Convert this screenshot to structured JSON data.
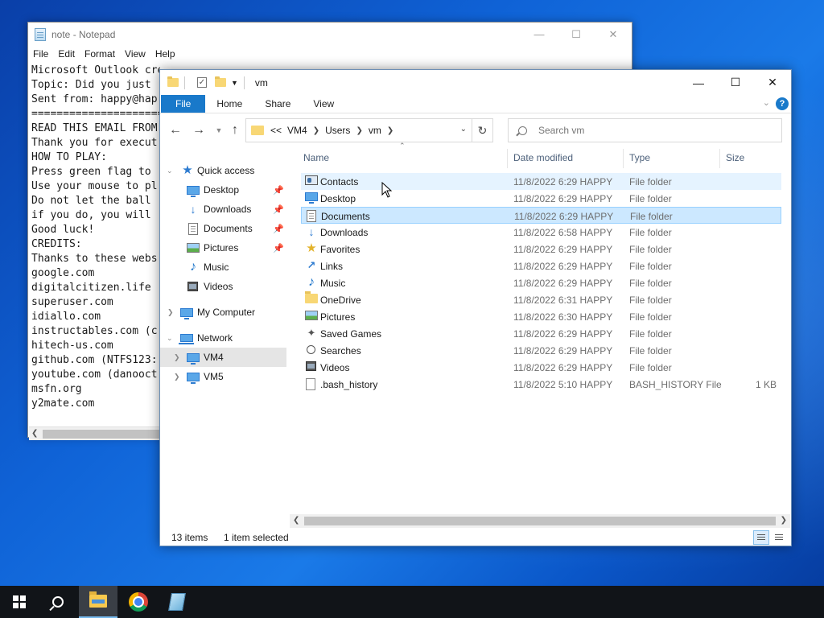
{
  "notepad": {
    "title": "note - Notepad",
    "menu": [
      "File",
      "Edit",
      "Format",
      "View",
      "Help"
    ],
    "lines": [
      "Microsoft Outlook created a .txt document. You have just recieved a new email",
      "Topic: Did you just",
      "Sent from: happy@hap",
      "========================",
      "READ THIS EMAIL FROM",
      "Thank you for execut",
      "HOW TO PLAY:",
      "Press green flag to",
      "Use your mouse to pl",
      "Do not let the ball",
      "if you do, you will",
      "Good luck!",
      "CREDITS:",
      "Thanks to these webs",
      "google.com",
      "digitalcitizen.life",
      "superuser.com",
      "idiallo.com",
      "instructables.com (c",
      "hitech-us.com",
      "github.com (NTFS123:",
      "youtube.com (danooct",
      "msfn.org",
      "y2mate.com"
    ]
  },
  "explorer": {
    "title": "vm",
    "ribbon": {
      "file": "File",
      "home": "Home",
      "share": "Share",
      "view": "View",
      "help": "?"
    },
    "address": {
      "crumbs": [
        "VM4",
        "Users",
        "vm"
      ],
      "overflow": "<<"
    },
    "search": {
      "placeholder": "Search vm"
    },
    "nav": {
      "quick_access": "Quick access",
      "pinned": [
        "Desktop",
        "Downloads",
        "Documents",
        "Pictures"
      ],
      "unpinned": [
        "Music",
        "Videos"
      ],
      "my_computer": "My Computer",
      "network": "Network",
      "network_items": [
        "VM4",
        "VM5"
      ]
    },
    "columns": {
      "name": "Name",
      "date": "Date modified",
      "type": "Type",
      "size": "Size"
    },
    "files": [
      {
        "name": "Contacts",
        "date": "11/8/2022 6:29 HAPPY",
        "type": "File folder",
        "size": "",
        "icon": "contacts-icon"
      },
      {
        "name": "Desktop",
        "date": "11/8/2022 6:29 HAPPY",
        "type": "File folder",
        "size": "",
        "icon": "desktop-icon"
      },
      {
        "name": "Documents",
        "date": "11/8/2022 6:29 HAPPY",
        "type": "File folder",
        "size": "",
        "icon": "documents-icon"
      },
      {
        "name": "Downloads",
        "date": "11/8/2022 6:58 HAPPY",
        "type": "File folder",
        "size": "",
        "icon": "downloads-icon"
      },
      {
        "name": "Favorites",
        "date": "11/8/2022 6:29 HAPPY",
        "type": "File folder",
        "size": "",
        "icon": "favorites-icon"
      },
      {
        "name": "Links",
        "date": "11/8/2022 6:29 HAPPY",
        "type": "File folder",
        "size": "",
        "icon": "links-icon"
      },
      {
        "name": "Music",
        "date": "11/8/2022 6:29 HAPPY",
        "type": "File folder",
        "size": "",
        "icon": "music-icon"
      },
      {
        "name": "OneDrive",
        "date": "11/8/2022 6:31 HAPPY",
        "type": "File folder",
        "size": "",
        "icon": "folder-icon"
      },
      {
        "name": "Pictures",
        "date": "11/8/2022 6:30 HAPPY",
        "type": "File folder",
        "size": "",
        "icon": "pictures-icon"
      },
      {
        "name": "Saved Games",
        "date": "11/8/2022 6:29 HAPPY",
        "type": "File folder",
        "size": "",
        "icon": "saved-games-icon"
      },
      {
        "name": "Searches",
        "date": "11/8/2022 6:29 HAPPY",
        "type": "File folder",
        "size": "",
        "icon": "searches-icon"
      },
      {
        "name": "Videos",
        "date": "11/8/2022 6:29 HAPPY",
        "type": "File folder",
        "size": "",
        "icon": "videos-icon"
      },
      {
        "name": ".bash_history",
        "date": "11/8/2022 5:10 HAPPY",
        "type": "BASH_HISTORY File",
        "size": "1 KB",
        "icon": "file-icon"
      }
    ],
    "status": {
      "count": "13 items",
      "selection": "1 item selected"
    }
  }
}
